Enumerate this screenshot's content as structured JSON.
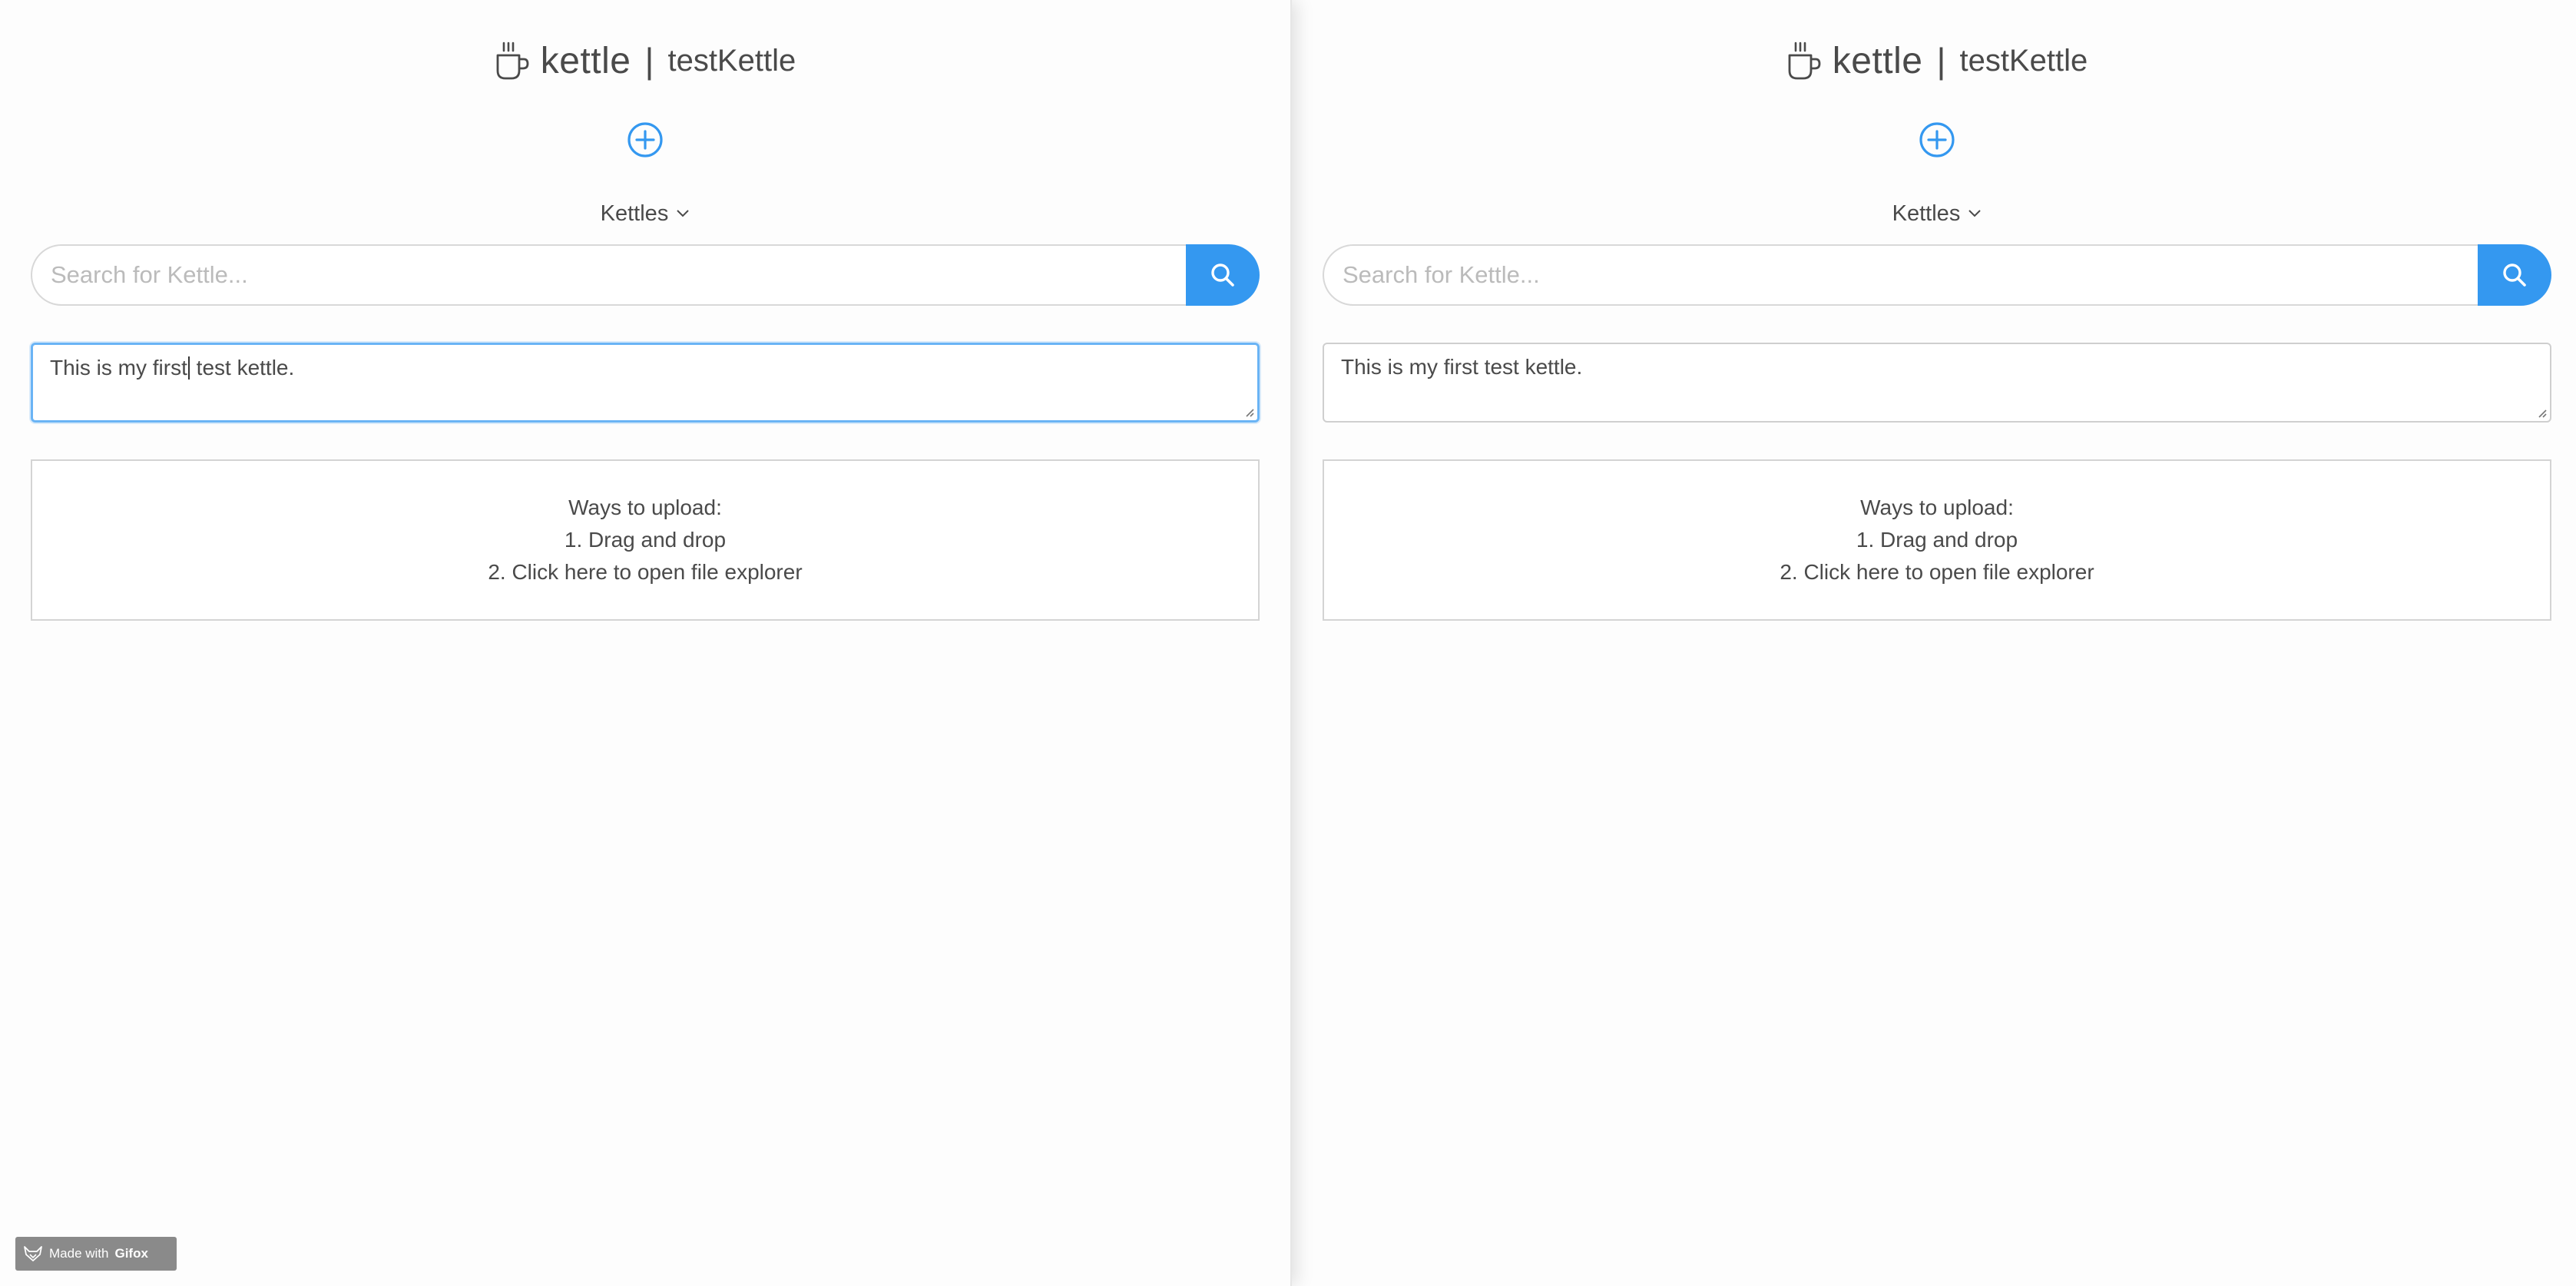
{
  "windows": [
    {
      "header": {
        "brand": "kettle",
        "divider": "|",
        "app_name": "testKettle"
      },
      "dropdown": {
        "label": "Kettles"
      },
      "search": {
        "placeholder": "Search for Kettle..."
      },
      "textarea": {
        "before_caret": "This is my first",
        "after_caret": " test kettle.",
        "focused": true
      },
      "upload": {
        "title": "Ways to upload:",
        "option1": "1. Drag and drop",
        "option2": "2. Click here to open file explorer"
      }
    },
    {
      "header": {
        "brand": "kettle",
        "divider": "|",
        "app_name": "testKettle"
      },
      "dropdown": {
        "label": "Kettles"
      },
      "search": {
        "placeholder": "Search for Kettle..."
      },
      "textarea": {
        "value": "This is my first test kettle.",
        "focused": false
      },
      "upload": {
        "title": "Ways to upload:",
        "option1": "1. Drag and drop",
        "option2": "2. Click here to open file explorer"
      }
    }
  ],
  "watermark": {
    "prefix": "Made with",
    "brand": "Gifox"
  },
  "icons": {
    "logo": "coffee-cup-icon",
    "add": "plus-circle-icon",
    "search": "search-icon",
    "dropdown": "chevron-down-icon",
    "watermark": "fox-icon"
  },
  "colors": {
    "accent": "#3498f0",
    "focus_border": "#6ab4f5",
    "text": "#4a4a4a"
  }
}
